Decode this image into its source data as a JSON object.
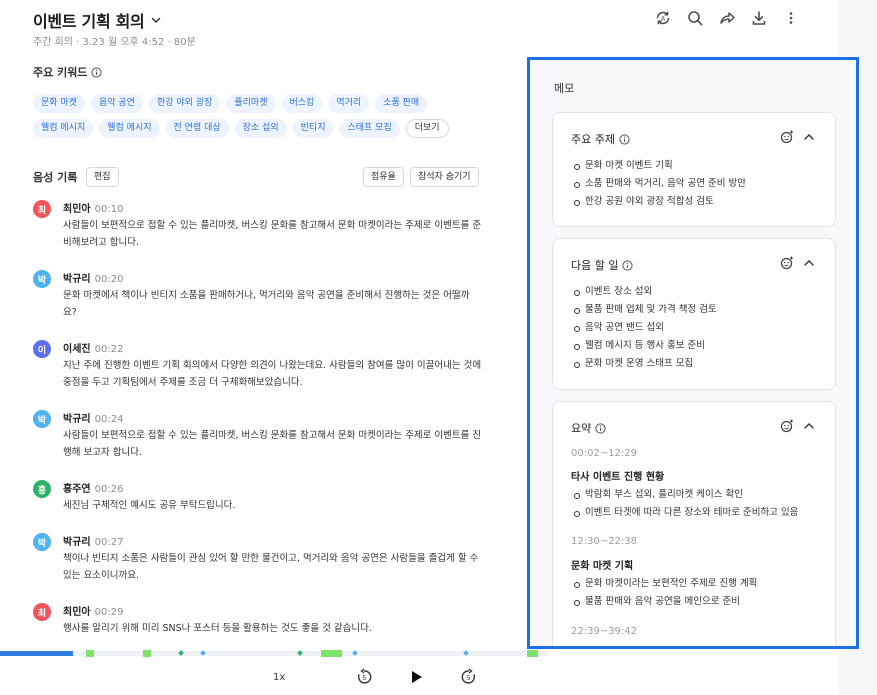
{
  "header": {
    "title": "이벤트 기획 회의",
    "subtitle": "주간 회의 · 3.23 월 오후 4:52 · 80분",
    "icons": [
      "sync-icon",
      "search-icon",
      "share-icon",
      "download-icon",
      "more-icon"
    ]
  },
  "keywords": {
    "title": "주요 키워드",
    "chips": [
      "문화 마켓",
      "음악 공연",
      "한강 야외 광장",
      "플리마켓",
      "버스킹",
      "먹거리",
      "소품 판매",
      "웰컴 메시지",
      "웰컴 메시지",
      "전 연령 대상",
      "장소 섭외",
      "빈티지",
      "스태프 모집"
    ],
    "more": "더보기"
  },
  "record": {
    "title": "음성 기록",
    "edit": "편집",
    "share_ratio": "점유율",
    "hide_participants": "참석자 숨기기",
    "entries": [
      {
        "initial": "최",
        "name": "최민아",
        "time": "00:10",
        "text": "사람들이 보편적으로 접할 수 있는 플리마켓, 버스킹 문화를 참고해서 문화 마켓이라는 주제로 이벤트를 준비해보려고 합니다."
      },
      {
        "initial": "박",
        "name": "박규리",
        "time": "00:20",
        "text": "문화 마켓에서 책이나 빈티지 소품을 판매하거나, 먹거리와 음악 공연을 준비해서 진행하는 것은 어떨까요?"
      },
      {
        "initial": "이",
        "name": "이세진",
        "time": "00:22",
        "text": "지난 주에 진행한 이벤트 기획 회의에서 다양한 의견이 나왔는데요. 사람들의 참여를 많이 이끌어내는 것에 중점을 두고 기획팀에서 주제를 조금 더 구체화해보았습니다."
      },
      {
        "initial": "박",
        "name": "박규리",
        "time": "00:24",
        "text": "사람들이 보편적으로 접할 수 있는 플리마켓, 버스킹 문화를 참고해서 문화 마켓이라는 주제로 이벤트를 진행해 보고자 합니다."
      },
      {
        "initial": "홍",
        "name": "홍주연",
        "time": "00:26",
        "text": "세진님 구체적인 예시도 공유 부탁드립니다."
      },
      {
        "initial": "박",
        "name": "박규리",
        "time": "00:27",
        "text": "책이나 빈티지 소품은 사람들이 관심 있어 할 만한 물건이고, 먹거리와 음악 공연은 사람들을 즐겁게 할 수 있는 요소이니까요."
      },
      {
        "initial": "최",
        "name": "최민아",
        "time": "00:29",
        "text": "행사를 알리기 위해 미리 SNS나 포스터 등을 활용하는 것도 좋을 것 같습니다."
      }
    ]
  },
  "player": {
    "speed": "1x",
    "rewind": "5",
    "forward": "5",
    "progress": 0.13
  },
  "memo": {
    "title": "메모",
    "cards": [
      {
        "title": "주요 주제",
        "items": [
          "문화 마켓 이벤트 기획",
          "소품 판매와 먹거리, 음악 공연 준비 방안",
          "한강 공원 야외 광장 적합성 검토"
        ]
      },
      {
        "title": "다음 할 일",
        "items": [
          "이벤트 장소 섭외",
          "물품 판매 업체 및 가격 책정 검토",
          "음악 공연 밴드 섭외",
          "웰컴 메시지 등 행사 홍보 준비",
          "문화 마켓 운영 스태프 모집"
        ]
      }
    ],
    "summary": {
      "title": "요약",
      "sections": [
        {
          "time": "00:02~12:29",
          "heading": "타사 이벤트 진행 현황",
          "items": [
            "박람회 부스 섭외, 플리마켓 케이스 확인",
            "이벤트 타겟에 따라 다른 장소와 테마로 준비하고 있음"
          ]
        },
        {
          "time": "12:30~22:38",
          "heading": "문화 마켓 기획",
          "items": [
            "문화 마켓이라는 보편적인 주제로 진행 계획",
            "물품 판매와 음악 공연을 메인으로 준비"
          ]
        },
        {
          "time": "22:39~39:42"
        }
      ]
    }
  },
  "colors": {
    "accent": "#2f7de1",
    "highlight_border": "#1d6fe6",
    "chip_text": "#2f6fd8",
    "chip_bg": "#eef4ff",
    "avatar_choi": "#f2545b",
    "avatar_park": "#4fb3f0",
    "avatar_lee": "#5b6ef0",
    "avatar_hong": "#2fb36b",
    "timeline_segment": "#7ee36b"
  }
}
